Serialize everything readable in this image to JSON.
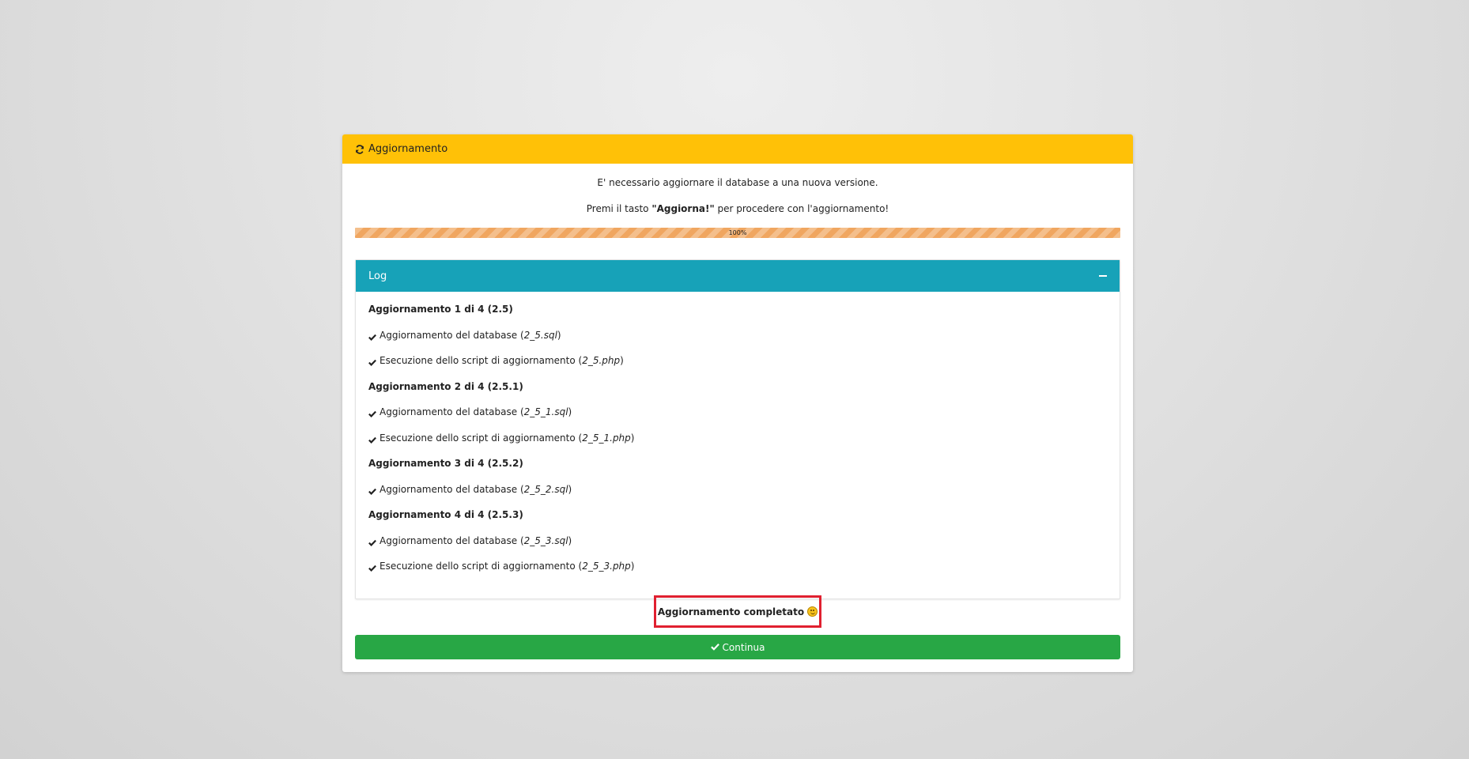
{
  "panel": {
    "title": "Aggiornamento",
    "icon": "refresh-icon",
    "header_color": "#ffc107"
  },
  "intro": {
    "line1": "E' necessario aggiornare il database a una nuova versione.",
    "line2_prefix": "Premi il tasto ",
    "line2_bold": "\"Aggiorna!\"",
    "line2_suffix": " per procedere con l'aggiornamento!"
  },
  "progress": {
    "value": 100,
    "label": "100%",
    "color": "#f0a660"
  },
  "log": {
    "title": "Log",
    "header_color": "#17a2b8",
    "collapse_icon": "minus-icon",
    "entries": [
      {
        "type": "title",
        "text": "Aggiornamento 1 di 4 (2.5)"
      },
      {
        "type": "step",
        "prefix": "Aggiornamento del database (",
        "file": "2_5.sql",
        "suffix": ")"
      },
      {
        "type": "step",
        "prefix": "Esecuzione dello script di aggiornamento (",
        "file": "2_5.php",
        "suffix": ")"
      },
      {
        "type": "title",
        "text": "Aggiornamento 2 di 4 (2.5.1)"
      },
      {
        "type": "step",
        "prefix": "Aggiornamento del database (",
        "file": "2_5_1.sql",
        "suffix": ")"
      },
      {
        "type": "step",
        "prefix": "Esecuzione dello script di aggiornamento (",
        "file": "2_5_1.php",
        "suffix": ")"
      },
      {
        "type": "title",
        "text": "Aggiornamento 3 di 4 (2.5.2)"
      },
      {
        "type": "step",
        "prefix": "Aggiornamento del database (",
        "file": "2_5_2.sql",
        "suffix": ")"
      },
      {
        "type": "title",
        "text": "Aggiornamento 4 di 4 (2.5.3)"
      },
      {
        "type": "step",
        "prefix": "Aggiornamento del database (",
        "file": "2_5_3.sql",
        "suffix": ")"
      },
      {
        "type": "step",
        "prefix": "Esecuzione dello script di aggiornamento (",
        "file": "2_5_3.php",
        "suffix": ")"
      }
    ]
  },
  "completion": {
    "text": "Aggiornamento completato",
    "icon": "smile-icon",
    "highlight_color": "#e02030"
  },
  "continue_button": {
    "label": "Continua",
    "icon": "check-icon",
    "color": "#28a745"
  }
}
